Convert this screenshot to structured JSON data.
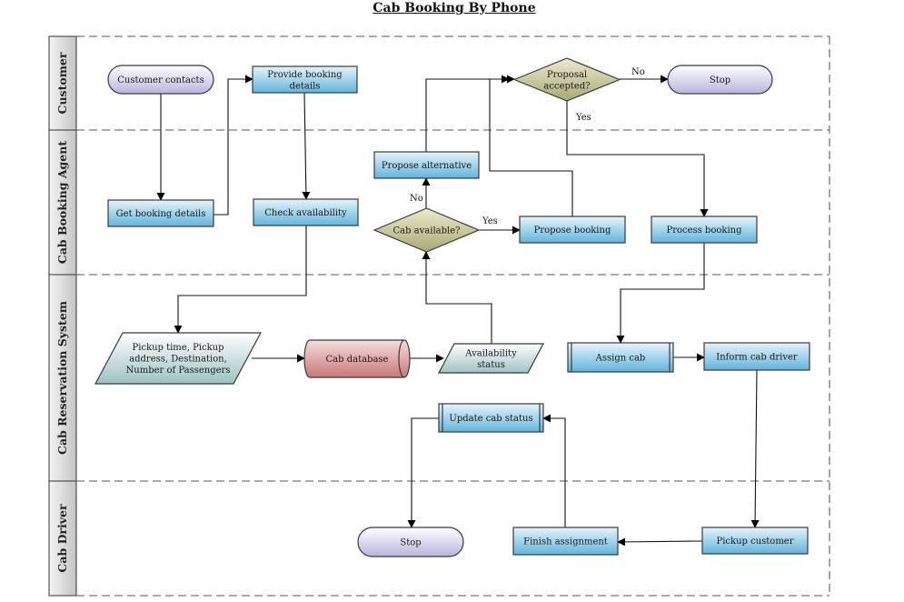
{
  "title": "Cab Booking By Phone",
  "colors": {
    "process_top": "#e6f4fb",
    "process_bottom": "#62b4dc",
    "terminal_top": "#ffffff",
    "terminal_bottom": "#b8b4dd",
    "decision_top": "#ecebcd",
    "decision_bottom": "#a8a874",
    "data_top": "#ffffff",
    "data_bottom": "#9fc2c2",
    "database_top": "#f6dcdc",
    "database_bottom": "#c77878",
    "lane_label_bg": "#d4d4d4",
    "lane_divider": "#777777"
  },
  "lanes": [
    {
      "id": "customer",
      "label": "Customer"
    },
    {
      "id": "agent",
      "label": "Cab Booking Agent"
    },
    {
      "id": "system",
      "label": "Cab Reservation System"
    },
    {
      "id": "driver",
      "label": "Cab Driver"
    }
  ],
  "nodes": {
    "customer_contacts": {
      "type": "terminal",
      "lines": [
        "Customer contacts"
      ]
    },
    "provide_details": {
      "type": "process",
      "lines": [
        "Provide booking",
        "details"
      ]
    },
    "proposal_accepted": {
      "type": "decision",
      "lines": [
        "Proposal",
        "accepted?"
      ]
    },
    "stop_top": {
      "type": "terminal",
      "lines": [
        "Stop"
      ]
    },
    "get_details": {
      "type": "process",
      "lines": [
        "Get booking details"
      ]
    },
    "check_availability": {
      "type": "process",
      "lines": [
        "Check availability"
      ]
    },
    "propose_alternative": {
      "type": "process",
      "lines": [
        "Propose alternative"
      ]
    },
    "cab_available": {
      "type": "decision",
      "lines": [
        "Cab  available?"
      ]
    },
    "propose_booking": {
      "type": "process",
      "lines": [
        "Propose booking"
      ]
    },
    "process_booking": {
      "type": "process",
      "lines": [
        "Process booking"
      ]
    },
    "pickup_data": {
      "type": "data",
      "lines": [
        "Pickup time,  Pickup",
        "address, Destination,",
        "Number of Passengers"
      ]
    },
    "cab_database": {
      "type": "database",
      "lines": [
        "Cab database"
      ]
    },
    "availability_status": {
      "type": "data",
      "lines": [
        "Availability",
        "status"
      ]
    },
    "assign_cab": {
      "type": "subprocess",
      "lines": [
        "Assign cab"
      ]
    },
    "inform_driver": {
      "type": "process",
      "lines": [
        "Inform cab driver"
      ]
    },
    "update_status": {
      "type": "subprocess",
      "lines": [
        "Update cab status"
      ]
    },
    "stop_bottom": {
      "type": "terminal",
      "lines": [
        "Stop"
      ]
    },
    "finish_assignment": {
      "type": "process",
      "lines": [
        "Finish assignment"
      ]
    },
    "pickup_customer": {
      "type": "process",
      "lines": [
        "Pickup customer"
      ]
    }
  },
  "edges": [
    {
      "from": "customer_contacts",
      "to": "get_details",
      "label": ""
    },
    {
      "from": "get_details",
      "to": "provide_details",
      "label": ""
    },
    {
      "from": "provide_details",
      "to": "check_availability",
      "label": ""
    },
    {
      "from": "check_availability",
      "to": "pickup_data",
      "label": ""
    },
    {
      "from": "pickup_data",
      "to": "cab_database",
      "label": ""
    },
    {
      "from": "cab_database",
      "to": "availability_status",
      "label": ""
    },
    {
      "from": "availability_status",
      "to": "cab_available",
      "label": ""
    },
    {
      "from": "cab_available",
      "to": "propose_booking",
      "label": "Yes"
    },
    {
      "from": "cab_available",
      "to": "propose_alternative",
      "label": "No"
    },
    {
      "from": "propose_alternative",
      "to": "proposal_accepted",
      "label": ""
    },
    {
      "from": "propose_booking",
      "to": "proposal_accepted",
      "label": ""
    },
    {
      "from": "proposal_accepted",
      "to": "stop_top",
      "label": "No"
    },
    {
      "from": "proposal_accepted",
      "to": "process_booking",
      "label": "Yes"
    },
    {
      "from": "process_booking",
      "to": "assign_cab",
      "label": ""
    },
    {
      "from": "assign_cab",
      "to": "inform_driver",
      "label": ""
    },
    {
      "from": "inform_driver",
      "to": "pickup_customer",
      "label": ""
    },
    {
      "from": "pickup_customer",
      "to": "finish_assignment",
      "label": ""
    },
    {
      "from": "finish_assignment",
      "to": "update_status",
      "label": ""
    },
    {
      "from": "update_status",
      "to": "stop_bottom",
      "label": ""
    }
  ]
}
